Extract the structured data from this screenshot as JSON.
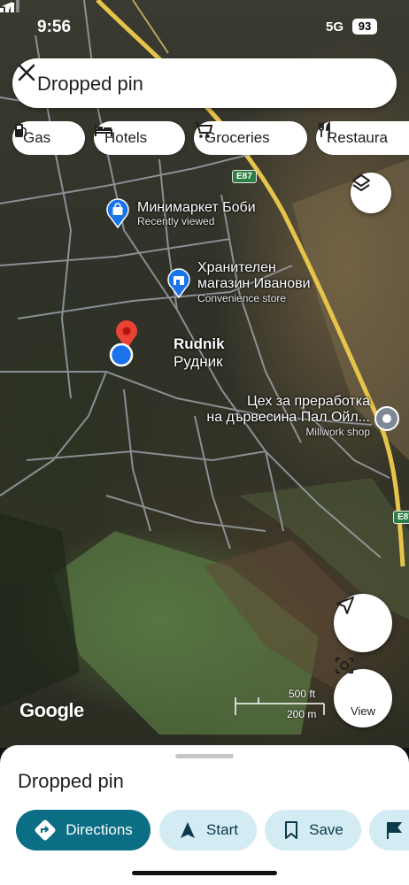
{
  "status_bar": {
    "time": "9:56",
    "network": "5G",
    "battery": "93"
  },
  "search": {
    "text": "Dropped pin"
  },
  "chips": [
    {
      "label": "Gas",
      "icon": "gas-station-icon"
    },
    {
      "label": "Hotels",
      "icon": "bed-icon"
    },
    {
      "label": "Groceries",
      "icon": "cart-icon"
    },
    {
      "label": "Restaura",
      "icon": "fork-knife-icon"
    }
  ],
  "map": {
    "road_shield_1": "E87",
    "road_shield_2": "E87",
    "pois": [
      {
        "name": "Минимаркет Боби",
        "sub": "Recently viewed",
        "icon": "shopping-bag-icon"
      },
      {
        "name_line1": "Хранителен",
        "name_line2": "магазин Иванови",
        "sub": "Convenience store",
        "icon": "store-icon"
      },
      {
        "name_line1": "Цех за преработка",
        "name_line2": "на дървесина Пал Ойл...",
        "sub": "Millwork shop",
        "icon": "pin-dot-icon"
      }
    ],
    "town": {
      "latin": "Rudnik",
      "cyrillic": "Рудник"
    },
    "logo": "Google",
    "scale_ft": "500 ft",
    "scale_m": "200 m",
    "view_label": "View",
    "colors": {
      "dropped_pin": "#ea4335",
      "my_location": "#1a73e8",
      "poi_blue": "#1a73e8",
      "poi_gray": "#7d8a95"
    }
  },
  "sheet": {
    "title": "Dropped pin",
    "actions": [
      {
        "label": "Directions",
        "icon": "directions-icon"
      },
      {
        "label": "Start",
        "icon": "navigation-arrow-icon"
      },
      {
        "label": "Save",
        "icon": "bookmark-icon"
      },
      {
        "label": "",
        "icon": "flag-icon"
      }
    ],
    "colors": {
      "primary": "#0b6e84",
      "secondary": "#d3ebf3"
    }
  }
}
